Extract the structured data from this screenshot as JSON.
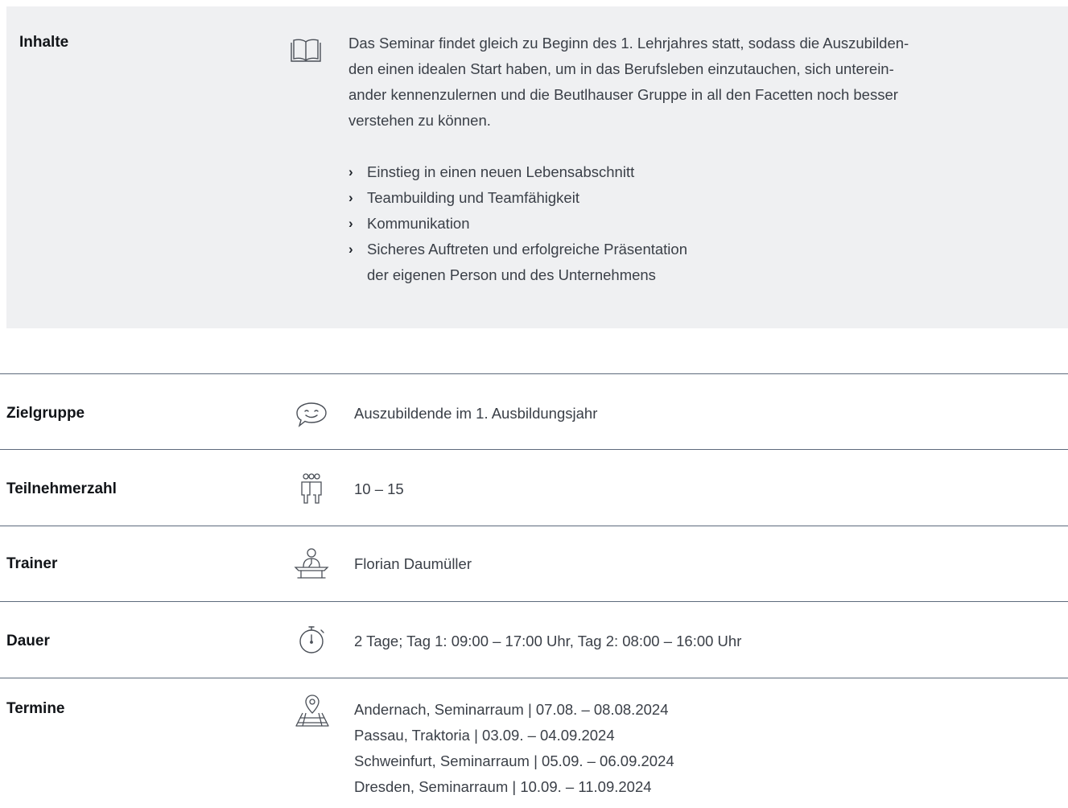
{
  "inhalte": {
    "label": "Inhalte",
    "icon": "book-icon",
    "text_lines": [
      "Das Seminar findet gleich zu Beginn des 1. Lehrjahres statt, sodass die Auszubilden-",
      "den einen idealen Start haben, um in das Berufsleben einzutauchen, sich unterein-",
      "ander kennenzulernen und die Beutlhauser Gruppe in all den Facetten noch besser",
      "verstehen zu können."
    ],
    "bullets": [
      {
        "text": "Einstieg in einen neuen Lebensabschnitt"
      },
      {
        "text": "Teambuilding und Teamfähigkeit"
      },
      {
        "text": "Kommunikation"
      },
      {
        "text": "Sicheres Auftreten und erfolgreiche Präsentation",
        "continuation": "der eigenen Person und des Unternehmens"
      }
    ]
  },
  "rows": {
    "zielgruppe": {
      "label": "Zielgruppe",
      "icon": "speech-bubble-smile-icon",
      "value": "Auszubildende im 1. Ausbildungsjahr"
    },
    "teilnehmerzahl": {
      "label": "Teilnehmerzahl",
      "icon": "group-people-icon",
      "value": "10 – 15"
    },
    "trainer": {
      "label": "Trainer",
      "icon": "speaker-podium-icon",
      "value": "Florian Daumüller"
    },
    "dauer": {
      "label": "Dauer",
      "icon": "stopwatch-icon",
      "value": "2 Tage; Tag 1: 09:00 – 17:00 Uhr, Tag 2: 08:00 – 16:00 Uhr"
    },
    "termine": {
      "label": "Termine",
      "icon": "map-pin-icon",
      "dates": [
        "Andernach, Seminarraum | 07.08. – 08.08.2024",
        "Passau, Traktoria | 03.09. – 04.09.2024",
        "Schweinfurt, Seminarraum | 05.09. – 06.09.2024",
        "Dresden, Seminarraum | 10.09. – 11.09.2024"
      ]
    }
  }
}
